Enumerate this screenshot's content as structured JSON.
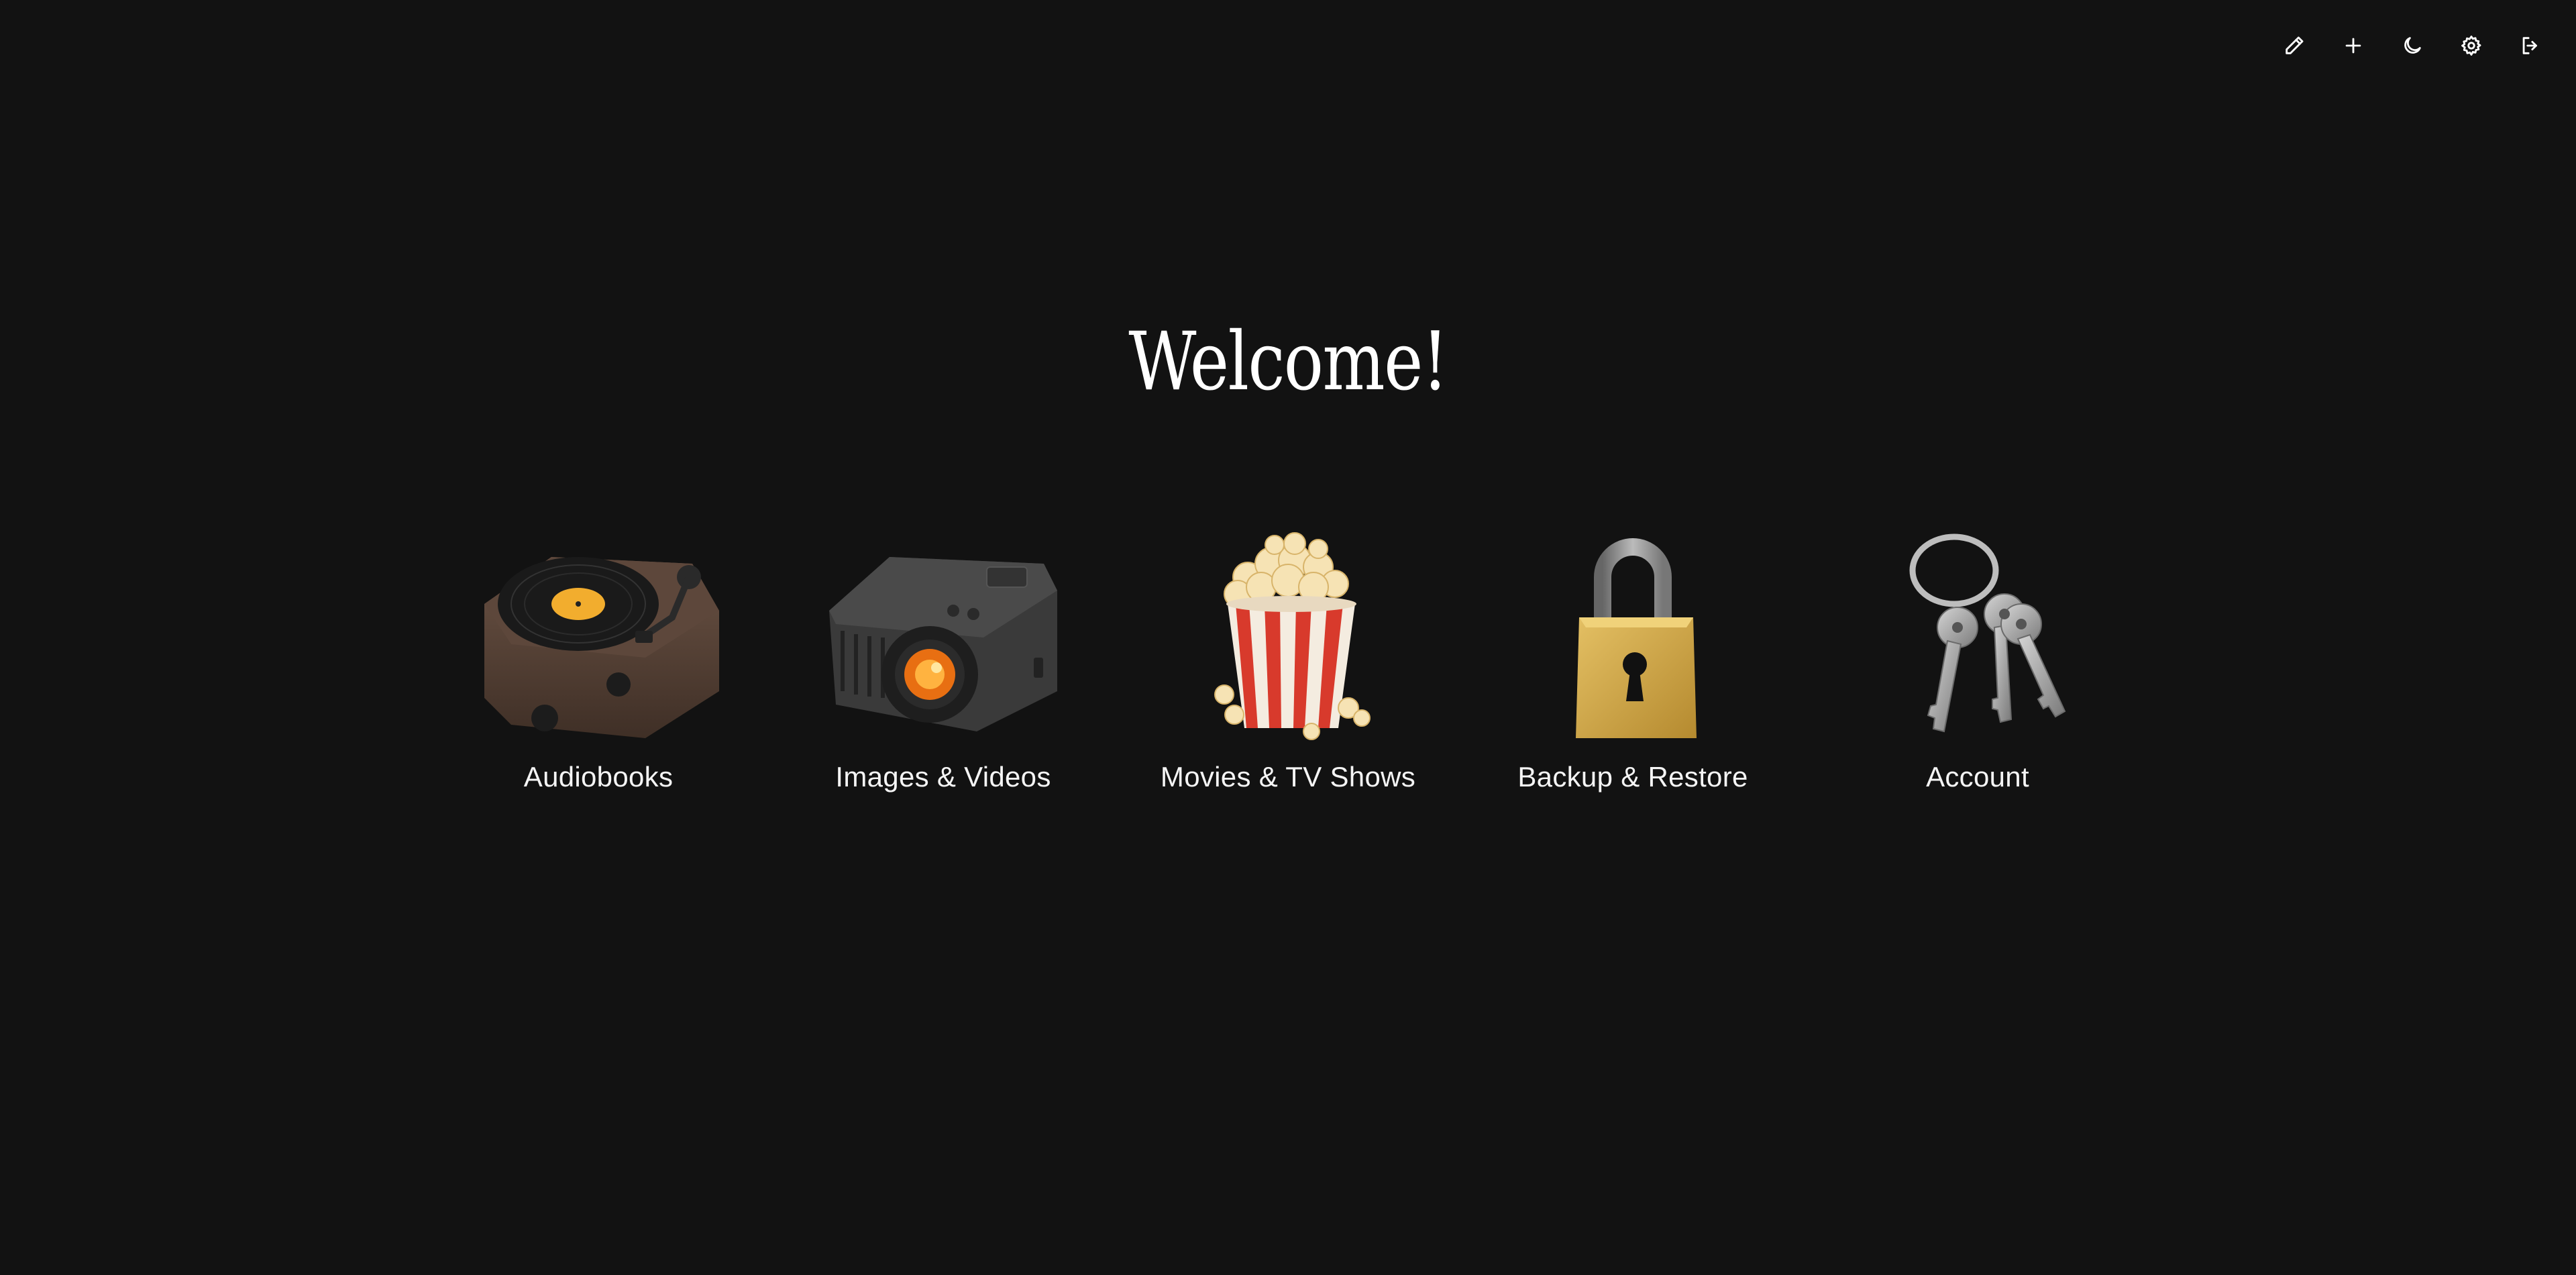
{
  "header": {
    "title": "Welcome!",
    "toolbar": [
      {
        "name": "edit-button",
        "icon": "pencil-icon"
      },
      {
        "name": "add-button",
        "icon": "plus-icon"
      },
      {
        "name": "theme-toggle-button",
        "icon": "moon-icon"
      },
      {
        "name": "settings-button",
        "icon": "gear-icon"
      },
      {
        "name": "logout-button",
        "icon": "logout-icon"
      }
    ]
  },
  "tiles": [
    {
      "label": "Audiobooks",
      "icon": "turntable-icon"
    },
    {
      "label": "Images & Videos",
      "icon": "projector-icon"
    },
    {
      "label": "Movies & TV Shows",
      "icon": "popcorn-icon"
    },
    {
      "label": "Backup & Restore",
      "icon": "padlock-icon"
    },
    {
      "label": "Account",
      "icon": "keys-icon"
    }
  ],
  "colors": {
    "background": "#121212",
    "text": "#f5f5f5",
    "accent": "#f2ad2e"
  }
}
